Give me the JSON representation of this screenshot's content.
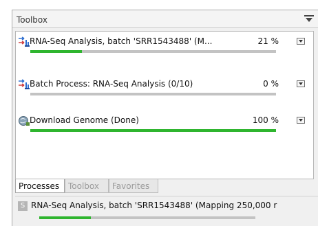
{
  "colors": {
    "progress_fill": "#2fb52f",
    "progress_track": "#c3c3c3"
  },
  "toolbox": {
    "title": "Toolbox",
    "menu_icon": "panel-menu-icon"
  },
  "processes": [
    {
      "name": "RNA-Seq Analysis, batch 'SRR1543488' (M...",
      "percent_label": "21 %",
      "progress": 0.21,
      "icon": "rna-seq-process-icon"
    },
    {
      "name": "Batch Process: RNA-Seq Analysis (0/10)",
      "percent_label": "0 %",
      "progress": 0.0,
      "icon": "batch-process-icon"
    },
    {
      "name": "Download Genome (Done)",
      "percent_label": "100 %",
      "progress": 1.0,
      "icon": "download-genome-icon"
    }
  ],
  "tabs": [
    {
      "label": "Processes",
      "active": true
    },
    {
      "label": "Toolbox",
      "active": false
    },
    {
      "label": "Favorites",
      "active": false
    }
  ],
  "status": {
    "icon_letter": "S",
    "text": "RNA-Seq Analysis, batch 'SRR1543488' (Mapping 250,000 r",
    "progress": 0.24
  }
}
